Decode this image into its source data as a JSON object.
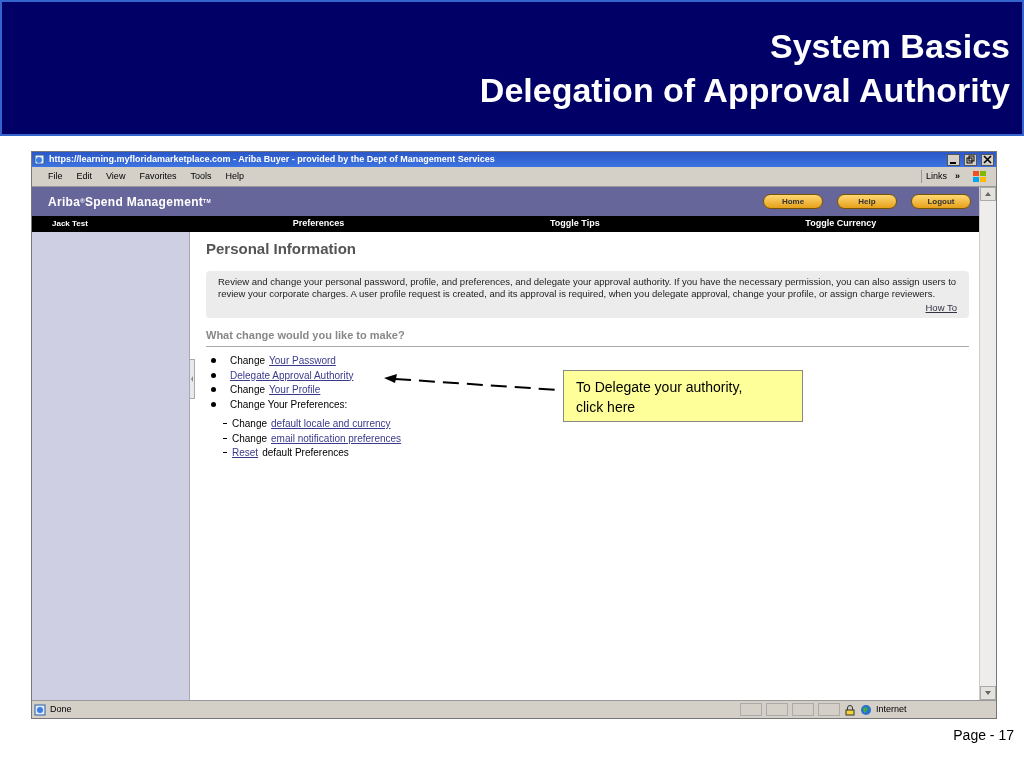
{
  "slide": {
    "title_lines": [
      "System Basics",
      "Delegation of Approval Authority"
    ],
    "page_label": "Page - 17"
  },
  "browser": {
    "title": "https://learning.myfloridamarketplace.com - Ariba Buyer - provided by the Dept of Management Services",
    "menu": [
      "File",
      "Edit",
      "View",
      "Favorites",
      "Tools",
      "Help"
    ],
    "links_label": "Links",
    "links_more": "»",
    "status_text": "Done",
    "zone": "Internet"
  },
  "app": {
    "brand": "Ariba",
    "registered": "®",
    "brand_rest": "Spend Management",
    "trademark": "TM",
    "header_buttons": [
      "Home",
      "Help",
      "Logout"
    ],
    "user": "Jack Test",
    "nav": [
      "Preferences",
      "Toggle Tips",
      "Toggle Currency"
    ],
    "heading": "Personal Information",
    "intro": "Review and change your personal password, profile, and preferences, and delegate your approval authority. If you have the necessary permission, you can also assign users to review your corporate charges. A user profile request is created, and its approval is required, when you delegate approval, change your profile, or assign charge reviewers.",
    "how_to": "How To",
    "question": "What change would you like to make?",
    "items": [
      {
        "kind": "bullet",
        "prefix": "Change",
        "link": "Your Password"
      },
      {
        "kind": "bullet",
        "link": "Delegate Approval Authority"
      },
      {
        "kind": "bullet",
        "prefix": "Change",
        "link": "Your Profile"
      },
      {
        "kind": "bullet",
        "prefix": "Change Your Preferences:"
      },
      {
        "kind": "dash",
        "prefix": "Change",
        "link": "default locale and currency"
      },
      {
        "kind": "dash",
        "prefix": "Change",
        "link": "email notification preferences"
      },
      {
        "kind": "dash",
        "link": "Reset",
        "suffix": "default Preferences"
      }
    ]
  },
  "callout": {
    "text": "To Delegate your authority, click here"
  }
}
